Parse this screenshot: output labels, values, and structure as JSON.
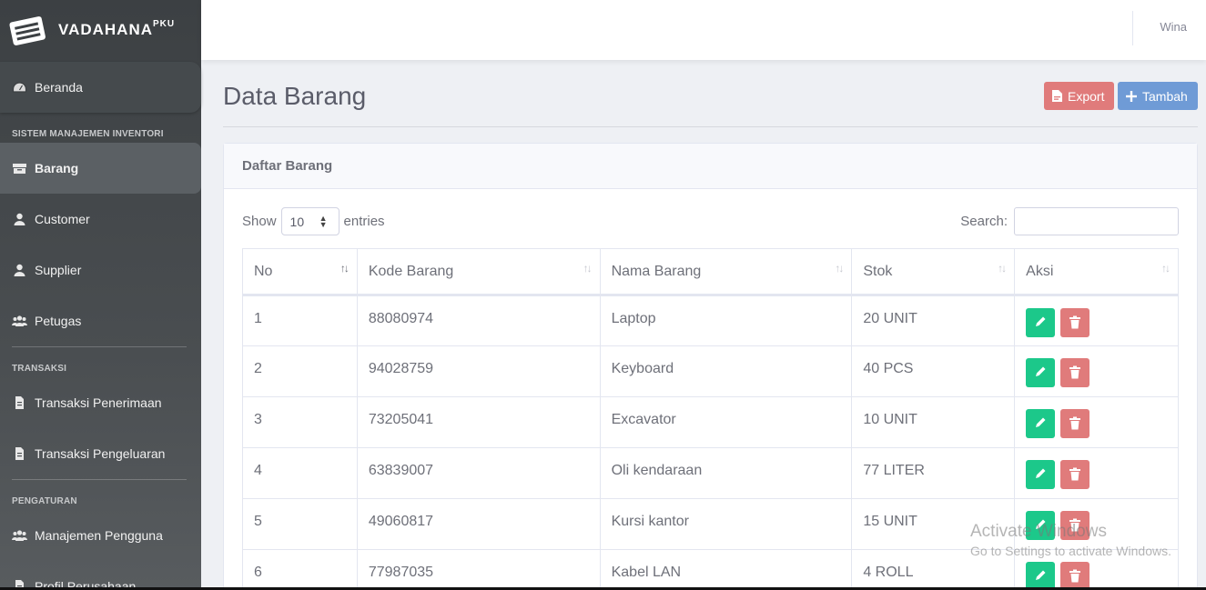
{
  "brand": {
    "name": "VADAHANA",
    "suffix": "PKU"
  },
  "topbar": {
    "user": "Wina"
  },
  "sidebar": {
    "home": "Beranda",
    "sections": [
      {
        "heading": "SISTEM MANAJEMEN INVENTORI",
        "items": [
          "Barang",
          "Customer",
          "Supplier",
          "Petugas"
        ]
      },
      {
        "heading": "TRANSAKSI",
        "items": [
          "Transaksi Penerimaan",
          "Transaksi Pengeluaran"
        ]
      },
      {
        "heading": "PENGATURAN",
        "items": [
          "Manajemen Pengguna",
          "Profil Perusahaan"
        ]
      }
    ]
  },
  "page": {
    "title": "Data Barang",
    "export_label": "Export",
    "add_label": "Tambah"
  },
  "card": {
    "header": "Daftar Barang",
    "show_label": "Show",
    "entries_label": "entries",
    "entries_value": "10",
    "search_label": "Search:"
  },
  "table": {
    "columns": [
      "No",
      "Kode Barang",
      "Nama Barang",
      "Stok",
      "Aksi"
    ],
    "rows": [
      [
        "1",
        "88080974",
        "Laptop",
        "20 UNIT"
      ],
      [
        "2",
        "94028759",
        "Keyboard",
        "40 PCS"
      ],
      [
        "3",
        "73205041",
        "Excavator",
        "10 UNIT"
      ],
      [
        "4",
        "63839007",
        "Oli kendaraan",
        "77 LITER"
      ],
      [
        "5",
        "49060817",
        "Kursi kantor",
        "15 UNIT"
      ],
      [
        "6",
        "77987035",
        "Kabel LAN",
        "4 ROLL"
      ]
    ]
  },
  "watermark": {
    "line1": "Activate Windows",
    "line2": "Go to Settings to activate Windows."
  },
  "colors": {
    "edit": "#1cc88a",
    "delete": "#e07b7b",
    "add": "#6f9bd6",
    "sidebar": "#3c4043"
  }
}
